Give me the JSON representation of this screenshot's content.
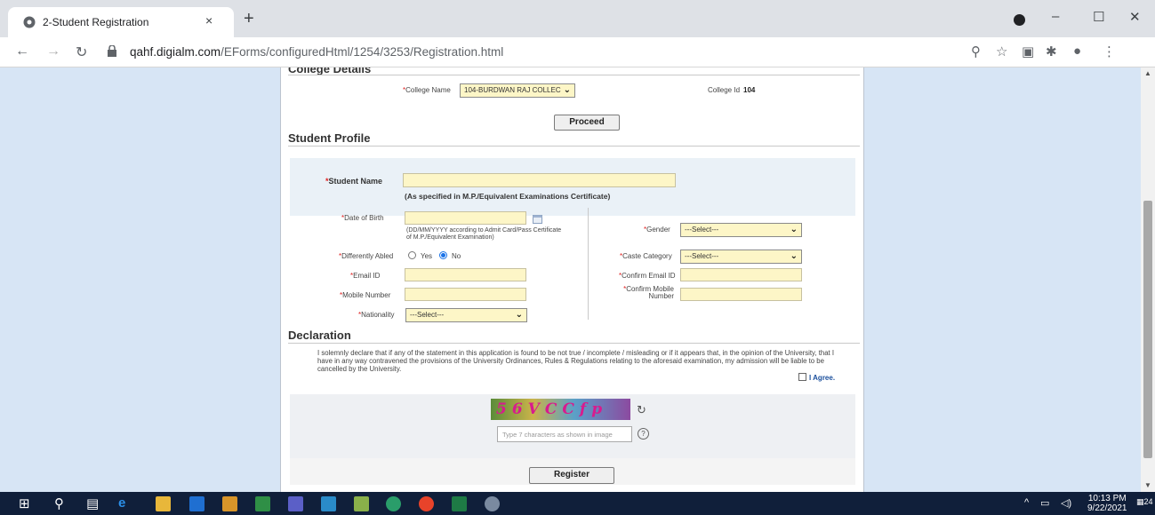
{
  "browser": {
    "tab_title": "2-Student Registration",
    "tab_close": "×",
    "new_tab": "+",
    "url_host": "qahf.digialm.com",
    "url_path": "/EForms/configuredHtml/1254/3253/Registration.html",
    "window_min": "–",
    "window_max": "☐",
    "window_close": "✕"
  },
  "college": {
    "section_title": "College Details",
    "name_label": "College Name",
    "name_value": "104-BURDWAN RAJ COLLEC",
    "id_label": "College Id",
    "id_value": "104",
    "proceed": "Proceed"
  },
  "profile": {
    "section_title": "Student Profile",
    "student_name_label": "Student Name",
    "student_name_hint": "(As specified in M.P./Equivalent Examinations Certificate)",
    "dob_label": "Date of Birth",
    "dob_hint": "(DD/MM/YYYY according to Admit Card/Pass Certificate of M.P./Equivalent Examination)",
    "differently_abled_label": "Differently Abled",
    "yes": "Yes",
    "no": "No",
    "differently_abled_selected": "No",
    "email_label": "Email ID",
    "mobile_label": "Mobile Number",
    "nationality_label": "Nationality",
    "nationality_value": "---Select---",
    "gender_label": "Gender",
    "gender_value": "---Select---",
    "caste_label": "Caste Category",
    "caste_value": "---Select---",
    "confirm_email_label": "Confirm Email ID",
    "confirm_mobile_label_1": "Confirm Mobile",
    "confirm_mobile_label_2": "Number"
  },
  "declaration": {
    "section_title": "Declaration",
    "text": "I solemnly declare that if any of the statement in this application is found to be not true / incomplete / misleading or if it appears that, in the opinion of the University, that I have in any way contravened the provisions of the University Ordinances, Rules & Regulations relating to the aforesaid examination, my admission will be liable to be cancelled by the University.",
    "agree": "I Agree."
  },
  "captcha": {
    "image_text": "56VCCfp",
    "placeholder": "Type 7 characters as shown in image"
  },
  "register": "Register",
  "taskbar": {
    "time": "10:13 PM",
    "date": "9/22/2021",
    "notifications": "24"
  },
  "colors": {
    "page_bg": "#d7e5f5",
    "field_bg": "#fdf6c7",
    "required": "#e02020",
    "taskbar": "#101f3a"
  }
}
